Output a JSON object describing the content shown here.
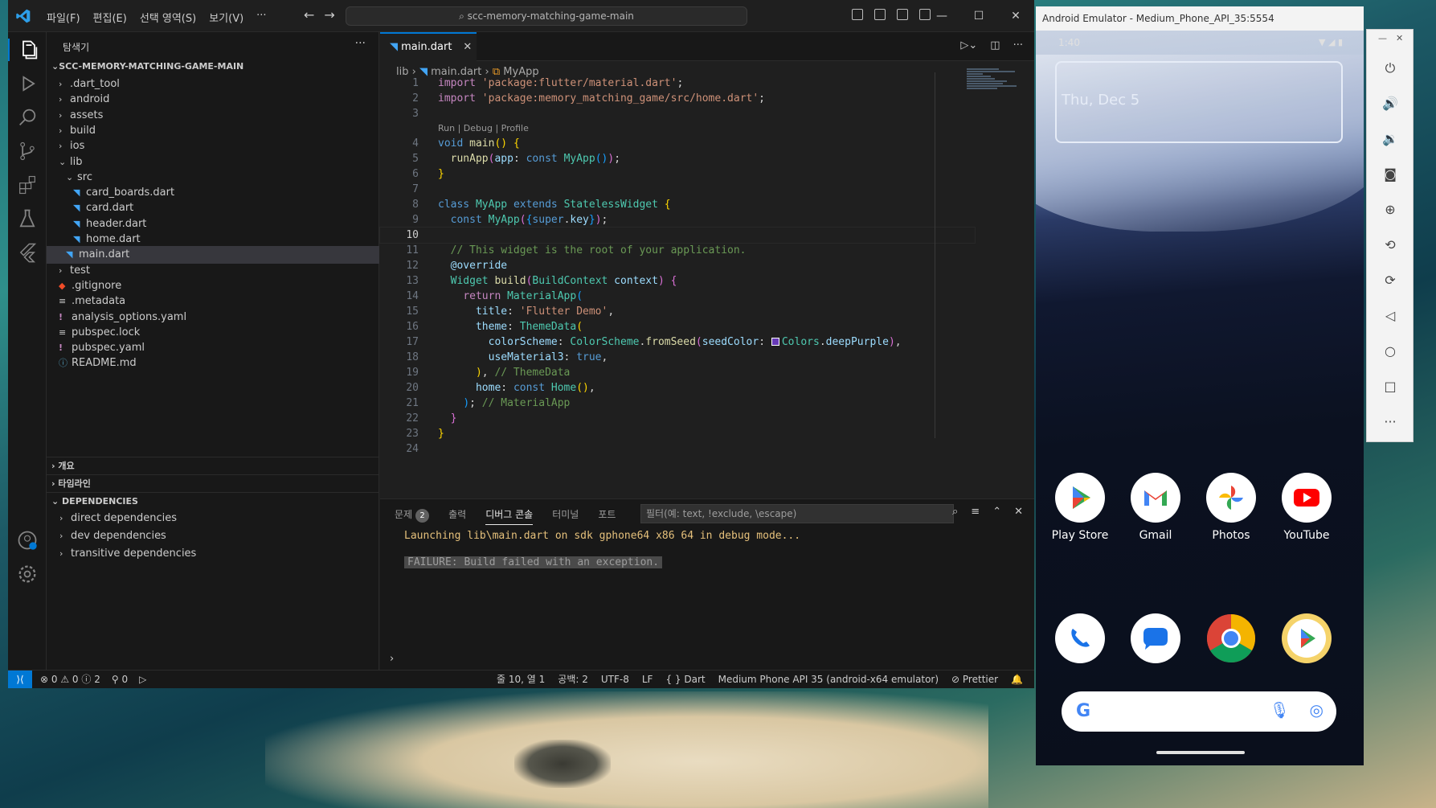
{
  "vscode": {
    "menu": [
      "파일(F)",
      "편집(E)",
      "선택 영역(S)",
      "보기(V)",
      "···"
    ],
    "search_text": "scc-memory-matching-game-main",
    "explorer_title": "탐색기",
    "project_title": "SCC-MEMORY-MATCHING-GAME-MAIN",
    "tree": [
      {
        "label": ".dart_tool",
        "depth": 1,
        "kind": "folder",
        "open": false
      },
      {
        "label": "android",
        "depth": 1,
        "kind": "folder",
        "open": false
      },
      {
        "label": "assets",
        "depth": 1,
        "kind": "folder",
        "open": false
      },
      {
        "label": "build",
        "depth": 1,
        "kind": "folder",
        "open": false
      },
      {
        "label": "ios",
        "depth": 1,
        "kind": "folder",
        "open": false
      },
      {
        "label": "lib",
        "depth": 1,
        "kind": "folder",
        "open": true
      },
      {
        "label": "src",
        "depth": 2,
        "kind": "folder",
        "open": true
      },
      {
        "label": "card_boards.dart",
        "depth": 3,
        "kind": "dart"
      },
      {
        "label": "card.dart",
        "depth": 3,
        "kind": "dart"
      },
      {
        "label": "header.dart",
        "depth": 3,
        "kind": "dart"
      },
      {
        "label": "home.dart",
        "depth": 3,
        "kind": "dart"
      },
      {
        "label": "main.dart",
        "depth": 2,
        "kind": "dart",
        "selected": true
      },
      {
        "label": "test",
        "depth": 1,
        "kind": "folder",
        "open": false
      },
      {
        "label": ".gitignore",
        "depth": 1,
        "kind": "git"
      },
      {
        "label": ".metadata",
        "depth": 1,
        "kind": "meta"
      },
      {
        "label": "analysis_options.yaml",
        "depth": 1,
        "kind": "yaml"
      },
      {
        "label": "pubspec.lock",
        "depth": 1,
        "kind": "meta"
      },
      {
        "label": "pubspec.yaml",
        "depth": 1,
        "kind": "yaml"
      },
      {
        "label": "README.md",
        "depth": 1,
        "kind": "info"
      }
    ],
    "sections": {
      "outline": "개요",
      "timeline": "타임라인",
      "dependencies": "DEPENDENCIES",
      "dep_items": [
        "direct dependencies",
        "dev dependencies",
        "transitive dependencies"
      ]
    },
    "tab_label": "main.dart",
    "breadcrumb": {
      "folder": "lib",
      "file": "main.dart",
      "symbol": "MyApp"
    },
    "codelens": "Run | Debug | Profile",
    "current_line": 10,
    "panel": {
      "tabs": [
        "문제",
        "출력",
        "디버그 콘솔",
        "터미널",
        "포트"
      ],
      "problems_count": "2",
      "filter_placeholder": "필터(예: text, !exclude, \\escape)",
      "console_line1": "Launching lib\\main.dart on sdk gphone64 x86 64 in debug mode...",
      "console_line2": "FAILURE: Build failed with an exception."
    },
    "status": {
      "errors": "0",
      "warnings": "0",
      "infos": "2",
      "ports": "0",
      "position": "줄 10, 열 1",
      "spaces": "공백: 2",
      "encoding": "UTF-8",
      "eol": "LF",
      "language": "Dart",
      "device": "Medium Phone API 35 (android-x64 emulator)",
      "formatter": "Prettier"
    }
  },
  "emulator": {
    "title": "Android Emulator - Medium_Phone_API_35:5554",
    "time": "1:40",
    "widget_date": "Thu, Dec 5",
    "apps_row1": [
      "Play Store",
      "Gmail",
      "Photos",
      "YouTube"
    ],
    "colors": {
      "accent": "#0078d4",
      "swatch": "#673ab7"
    }
  }
}
